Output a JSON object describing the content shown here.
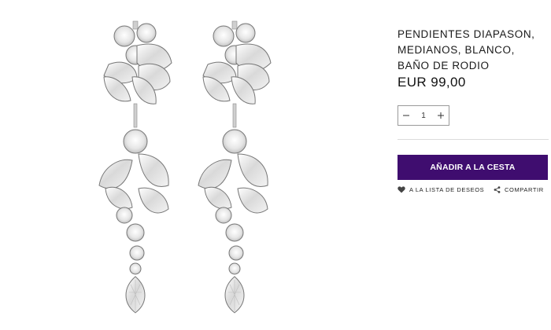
{
  "product": {
    "title": "PENDIENTES DIAPASON, MEDIANOS, BLANCO, BAÑO DE RODIO",
    "price": "EUR 99,00",
    "image_icon": "earrings-product-image"
  },
  "quantity": {
    "value": "1",
    "decrement_icon": "minus-icon",
    "increment_icon": "plus-icon"
  },
  "actions": {
    "add_to_cart": "AÑADIR A LA CESTA",
    "wishlist": "A LA LISTA DE DESEOS",
    "share": "COMPARTIR"
  },
  "colors": {
    "accent": "#3f0d6f"
  }
}
